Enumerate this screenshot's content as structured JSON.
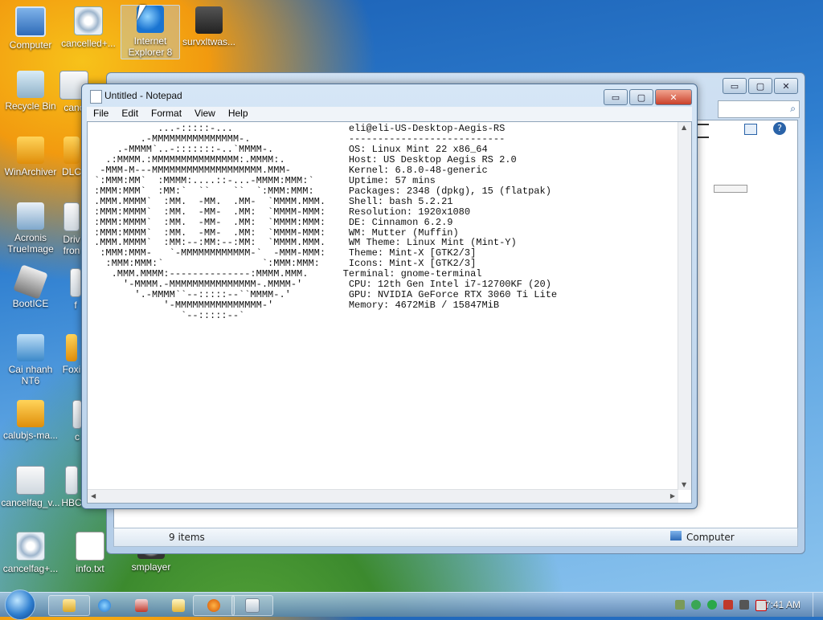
{
  "desktop": {
    "icons": [
      {
        "label": "Computer"
      },
      {
        "label": "cancelled+..."
      },
      {
        "label": "Internet Explorer 8"
      },
      {
        "label": "survxltwas..."
      },
      {
        "label": "Recycle Bin"
      },
      {
        "label": "canc"
      },
      {
        "label": "WinArchiver"
      },
      {
        "label": "DLC"
      },
      {
        "label": "Acronis TrueImage"
      },
      {
        "label": "Driv fron"
      },
      {
        "label": "BootICE"
      },
      {
        "label": "f"
      },
      {
        "label": "Cai nhanh NT6"
      },
      {
        "label": "Foxi"
      },
      {
        "label": "calubjs-ma..."
      },
      {
        "label": "c"
      },
      {
        "label": "cancelfag_v..."
      },
      {
        "label": "HBC"
      },
      {
        "label": "cancelfag+..."
      },
      {
        "label": "info.txt"
      },
      {
        "label": "smplayer"
      }
    ]
  },
  "explorer": {
    "status_items": "9 items",
    "status_location": "Computer",
    "min": "▭",
    "max": "▢",
    "close": "✕"
  },
  "notepad": {
    "title": "Untitled - Notepad",
    "menu": [
      "File",
      "Edit",
      "Format",
      "View",
      "Help"
    ],
    "min": "▭",
    "max": "▢",
    "close": "✕",
    "content": "           ...-:::::-...                    eli@eli-US-Desktop-Aegis-RS\n        .-MMMMMMMMMMMMMMM-.                 ---------------------------\n    .-MMMM`..-:::::::-..`MMMM-.             OS: Linux Mint 22 x86_64\n  .:MMMM.:MMMMMMMMMMMMMMM:.MMMM:.           Host: US Desktop Aegis RS 2.0\n -MMM-M---MMMMMMMMMMMMMMMMMMM.MMM-          Kernel: 6.8.0-48-generic\n`:MMM:MM`  :MMMM:....::-...-MMMM:MMM:`      Uptime: 57 mins\n:MMM:MMM`  :MM:`  ``    ``  `:MMM:MMM:      Packages: 2348 (dpkg), 15 (flatpak)\n.MMM.MMMM`  :MM.  -MM.  .MM-  `MMMM.MMM.    Shell: bash 5.2.21\n:MMM:MMMM`  :MM.  -MM-  .MM:  `MMMM-MMM:    Resolution: 1920x1080\n:MMM:MMMM`  :MM.  -MM-  .MM:  `MMMM:MMM:    DE: Cinnamon 6.2.9\n:MMM:MMMM`  :MM.  -MM-  .MM:  `MMMM-MMM:    WM: Mutter (Muffin)\n.MMM.MMMM`  :MM:--:MM:--:MM:  `MMMM.MMM.    WM Theme: Linux Mint (Mint-Y)\n :MMM:MMM-   `-MMMMMMMMMMMM-`  -MMM-MMM:    Theme: Mint-X [GTK2/3]\n  :MMM:MMM:`                 `:MMM:MMM:     Icons: Mint-X [GTK2/3]\n   .MMM.MMMM:--------------:MMMM.MMM.      Terminal: gnome-terminal\n     '-MMMM.-MMMMMMMMMMMMMMM-.MMMM-'        CPU: 12th Gen Intel i7-12700KF (20)\n       '.-MMMM``--:::::--``MMMM-.'          GPU: NVIDIA GeForce RTX 3060 Ti Lite\n            '-MMMMMMMMMMMMMMM-'             Memory: 4672MiB / 15847MiB\n               `--:::::--`"
  },
  "taskbar": {
    "clock": "7:41 AM"
  },
  "colors": {
    "accent": "#2f7fd0",
    "close_red": "#c9402a"
  }
}
